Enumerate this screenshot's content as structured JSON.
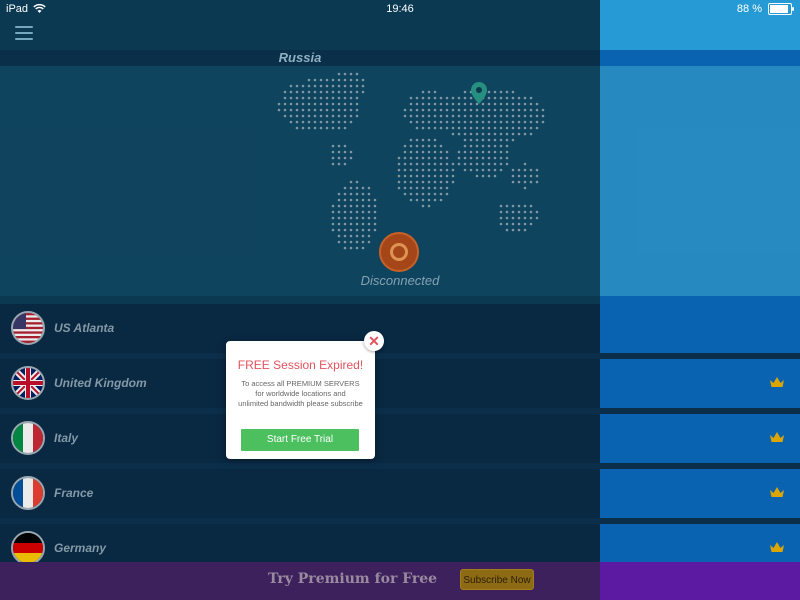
{
  "statusbar": {
    "device": "iPad",
    "time": "19:46",
    "battery": "88 %",
    "battery_level": 0.88
  },
  "header": {
    "country": "Russia"
  },
  "connection": {
    "status": "Disconnected"
  },
  "servers": [
    {
      "name": "US Atlanta",
      "flag": "us-flag",
      "premium": false
    },
    {
      "name": "United Kingdom",
      "flag": "uk-flag",
      "premium": true
    },
    {
      "name": "Italy",
      "flag": "italy-flag",
      "premium": true
    },
    {
      "name": "France",
      "flag": "france-flag",
      "premium": true
    },
    {
      "name": "Germany",
      "flag": "germany-flag",
      "premium": true
    }
  ],
  "modal": {
    "title": "FREE Session Expired!",
    "body_lines": [
      "To access all PREMIUM SERVERS",
      "for worldwide locations and",
      "unlimited bandwidth please subscribe"
    ],
    "button": "Start Free Trial",
    "close": "✕"
  },
  "banner": {
    "text": "Try Premium for Free",
    "button": "Subscribe Now"
  },
  "colors": {
    "accent": "#4cc05f",
    "alert": "#e2525e",
    "premium_crown": "#f0b400"
  }
}
